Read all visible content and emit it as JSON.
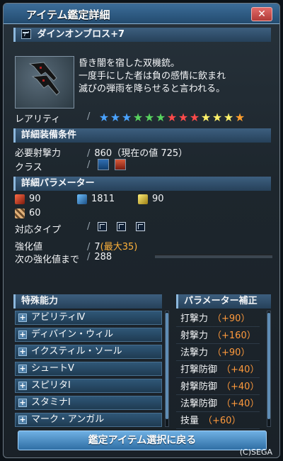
{
  "window": {
    "title": "アイテム鑑定詳細",
    "close_symbol": "✕"
  },
  "item": {
    "name": "ダインオンブロス+7",
    "description": [
      "昏き闇を宿した双機銃。",
      "一度手にした者は負の感情に飲まれ",
      "滅びの弾雨を降らせると言われる。"
    ]
  },
  "rarity": {
    "label": "レアリティ",
    "stars": 13,
    "star_colors": [
      "#4aa3ff",
      "#4aa3ff",
      "#4aa3ff",
      "#58d35f",
      "#58d35f",
      "#58d35f",
      "#ff4a4a",
      "#ff4a4a",
      "#ff4a4a",
      "#fff26a",
      "#fff26a",
      "#fff26a",
      "#ff9f2e"
    ]
  },
  "sections": {
    "equip_conditions": "詳細装備条件",
    "parameters": "詳細パラメーター"
  },
  "requirements": {
    "label": "必要射撃力",
    "value": "860（現在の値 725）",
    "class_label": "クラス"
  },
  "params": {
    "stats": [
      {
        "icon": "ranged-attack-icon",
        "value": "90"
      },
      {
        "icon": "ranged-attack-sword-icon",
        "value": "1811"
      },
      {
        "icon": "tech-attack-icon",
        "value": "90"
      },
      {
        "icon": "defense-icon",
        "value": "60"
      }
    ],
    "type_label": "対応タイプ",
    "type_glyphs": [
      "T",
      "E",
      "L"
    ],
    "grind_label": "強化値",
    "grind_value": "7",
    "grind_max": "(最大35)",
    "next_label": "次の強化値まで",
    "next_value": "288",
    "next_progress": 0.0
  },
  "abilities": {
    "header": "特殊能力",
    "items": [
      "アビリティⅣ",
      "ディバイン・ウィル",
      "イクスティル・ソール",
      "シュートⅤ",
      "スピリタⅠ",
      "スタミナⅠ",
      "マーク・アンガル"
    ]
  },
  "bonuses": {
    "header": "パラメーター補正",
    "items": [
      {
        "label": "打撃力",
        "value": "（+90）"
      },
      {
        "label": "射撃力",
        "value": "（+160）"
      },
      {
        "label": "法撃力",
        "value": "（+90）"
      },
      {
        "label": "打撃防御",
        "value": "（+40）"
      },
      {
        "label": "射撃防御",
        "value": "（+40）"
      },
      {
        "label": "法撃防御",
        "value": "（+40）"
      },
      {
        "label": "技量",
        "value": "（+60）"
      }
    ]
  },
  "footer": {
    "return_button": "鑑定アイテム選択に戻る",
    "copyright": "(C)SEGA"
  }
}
